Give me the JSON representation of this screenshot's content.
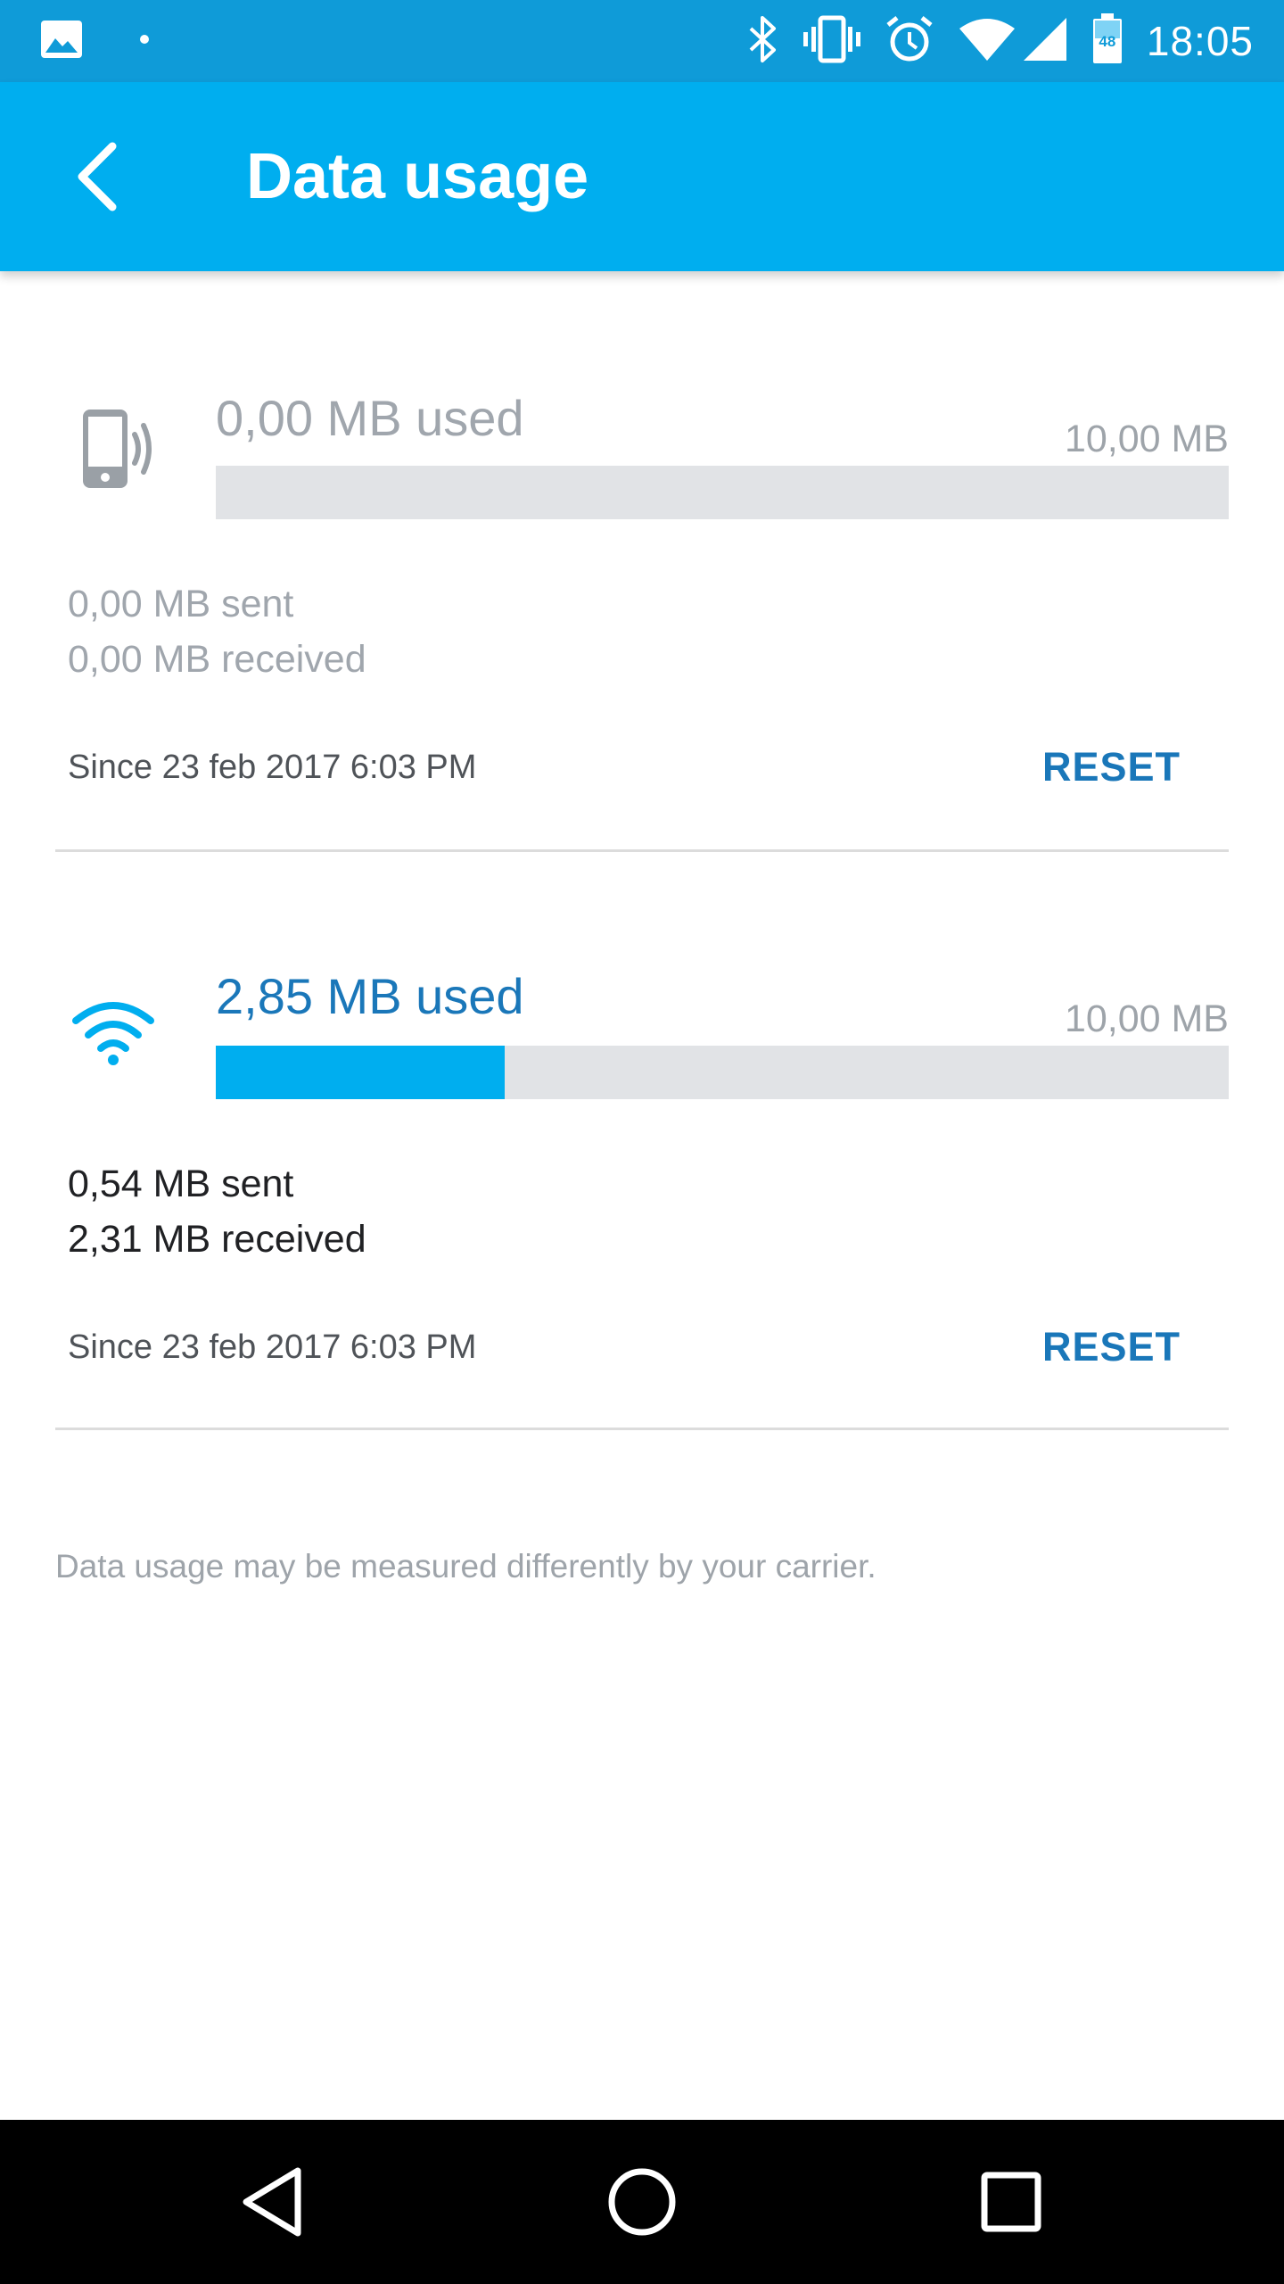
{
  "status_bar": {
    "time": "18:05",
    "battery_level": "48",
    "icons": [
      "image-icon",
      "dot-icon",
      "bluetooth-icon",
      "vibrate-icon",
      "alarm-icon",
      "wifi-icon",
      "cell-signal-icon",
      "battery-icon"
    ]
  },
  "app_bar": {
    "title": "Data usage"
  },
  "mobile": {
    "used": "0,00 MB used",
    "limit": "10,00 MB",
    "progress_fraction": 0.0,
    "sent": "0,00 MB sent",
    "received": "0,00 MB received",
    "since": "Since 23 feb 2017 6:03 PM",
    "reset_label": "RESET"
  },
  "wifi": {
    "used": "2,85 MB used",
    "limit": "10,00 MB",
    "progress_fraction": 0.285,
    "sent": "0,54 MB sent",
    "received": "2,31 MB received",
    "since": "Since 23 feb 2017 6:03 PM",
    "reset_label": "RESET"
  },
  "footnote": "Data usage may be measured differently by your carrier.",
  "colors": {
    "status_bar": "#0f9bd8",
    "app_bar": "#00aeef",
    "accent": "#1a77b9",
    "progress_fill": "#00aeef",
    "progress_track": "#e1e3e6"
  }
}
